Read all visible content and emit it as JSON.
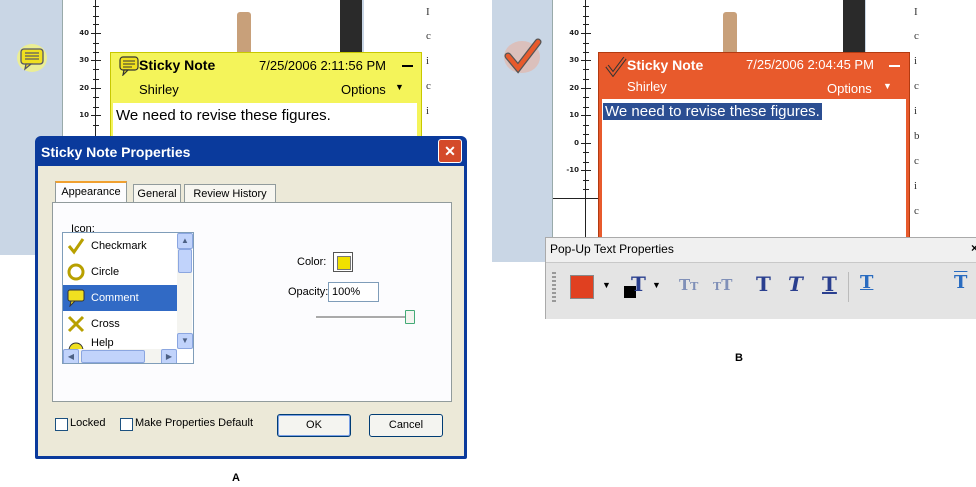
{
  "panel_a": {
    "ruler_labels": [
      "40",
      "30",
      "20",
      "10"
    ],
    "sticky": {
      "title": "Sticky Note",
      "date": "7/25/2006 2:11:56 PM",
      "author": "Shirley",
      "options": "Options",
      "text": "We need to revise these figures.",
      "color": "#f4f45a"
    },
    "dialog": {
      "title": "Sticky Note Properties",
      "tabs": [
        "Appearance",
        "General",
        "Review History"
      ],
      "icon_label": "Icon:",
      "icons": [
        "Checkmark",
        "Circle",
        "Comment",
        "Cross",
        "Help"
      ],
      "selected_icon": "Comment",
      "color_label": "Color:",
      "color_value": "#f0e000",
      "opacity_label": "Opacity:",
      "opacity_value": "100%",
      "locked_label": "Locked",
      "make_default_label": "Make Properties Default",
      "ok_label": "OK",
      "cancel_label": "Cancel"
    },
    "caption": "A"
  },
  "panel_b": {
    "ruler_labels": [
      "40",
      "30",
      "20",
      "10",
      "0",
      "-10"
    ],
    "sticky": {
      "title": "Sticky Note",
      "date": "7/25/2006 2:04:45 PM",
      "author": "Shirley",
      "options": "Options",
      "text": "We need to revise these figures.",
      "color": "#e85a2c"
    },
    "toolbar": {
      "title": "Pop-Up Text Properties",
      "fill_color": "#e04020",
      "text_color": "#000000"
    },
    "caption": "B"
  }
}
